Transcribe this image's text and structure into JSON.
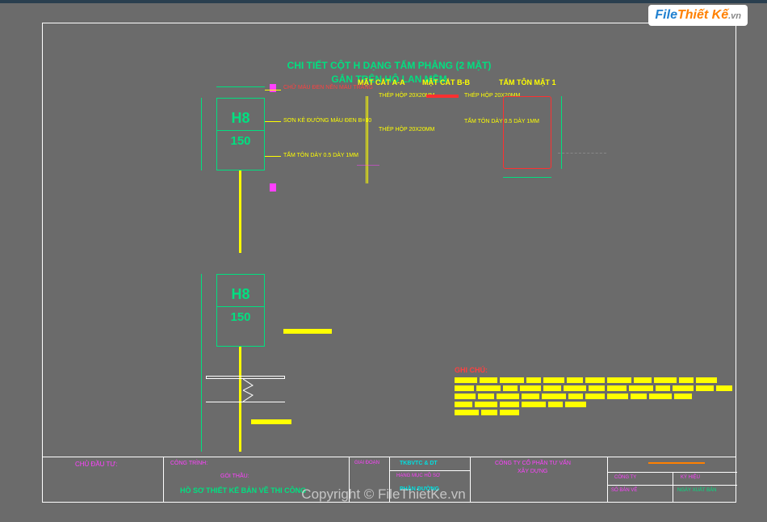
{
  "logo": {
    "prefix": "File",
    "mid": "Thiết Kế",
    "suffix": ".vn"
  },
  "title": {
    "line1": "CHI TIẾT CỘT H DẠNG TẤM PHẲNG (2 MẶT)",
    "line2": "GẮN TRÊN HỘ LAN MỀM"
  },
  "sections": {
    "mc_aa": "MẶT CẮT A-A",
    "mc_bb": "MẶT CẮT B-B",
    "tam_ton": "TẤM TÔN MẶT 1"
  },
  "annotations": {
    "chu_mau": "CHỮ MÀU ĐEN NỀN MÀU TRẮNG",
    "son_ke": "SƠN KẺ ĐƯỜNG MÀU ĐEN B=10",
    "tam_ton_day": "TẤM TÔN DÀY 0.5 DÀY 1MM",
    "thep_hop_1": "THÉP HỘP 20X20MM",
    "thep_hop_2": "THÉP HỘP 20X20MM",
    "thep_hop_3": "THÉP HỘP 20X20MM",
    "tam_ton_day2": "TẤM TÔN DÀY 0.5 DÀY 1MM"
  },
  "sign": {
    "h8": "H8",
    "km": "150"
  },
  "ghichu": "GHI CHÚ:",
  "titleblock": {
    "chu_dau_tu": "CHỦ ĐẦU TƯ:",
    "cong_trinh": "CÔNG TRÌNH:",
    "goi_thau": "GÓI THẦU:",
    "ho_so": "HỒ SƠ THIẾT KẾ BẢN VẼ THI CÔNG",
    "giai_doan": "GIAI ĐOẠN",
    "tktc": "TKBVTC & DT",
    "hang_muc": "HẠNG MỤC HỒ SƠ",
    "phan_duong": "PHẦN ĐƯỜNG",
    "tu_van": "CÔNG TY CỔ PHẦN TƯ VẤN",
    "xd": "XÂY DỰNG",
    "cong_ty": "CÔNG TY",
    "ky_hieu": "KÝ HIỆU",
    "so_ban_ve": "SỐ BẢN VẼ",
    "ngay": "NGÀY XUẤT BẢN"
  },
  "watermark": "Copyright © FileThietKe.vn"
}
